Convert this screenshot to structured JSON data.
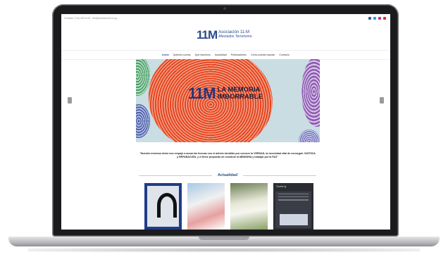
{
  "site": {
    "topbar": {
      "contact": "Contacto: (+34) 000 00 00 · info@asociacion11m.org"
    },
    "logo": {
      "mark": "11M",
      "line1": "Asociación 11-M",
      "line2": "Afectados Terrorismo"
    },
    "nav": {
      "items": [
        "Inicio",
        "Quiénes somos",
        "Qué hacemos",
        "Actualidad",
        "Publicaciones",
        "Cómo puedes ayudar",
        "Contacto"
      ],
      "active_index": 0
    },
    "hero": {
      "mark": "11M",
      "line1": "LA MEMORIA",
      "line2": "IMBORRABLE"
    },
    "quote": "\"Nuestro inmenso dolor nos empujó a aunar las fuerzas con el anhelo decidido por conocer la VERDAD, la necesidad vital de conseguir JUSTICIA y REPARACIÓN, y el firme propósito de construir la MEMORIA y trabajar por la PAZ\"",
    "section": {
      "title": "Actualidad"
    },
    "twitter": {
      "header": "Tweets by"
    }
  },
  "colors": {
    "brand": "#2a4b8d",
    "hero_red": "#e4451f",
    "bezel": "#1b1b1d"
  },
  "icons": [
    "facebook-icon",
    "twitter-icon",
    "instagram-icon",
    "youtube-icon",
    "prev-arrow-icon",
    "next-arrow-icon",
    "ribbon-icon"
  ]
}
